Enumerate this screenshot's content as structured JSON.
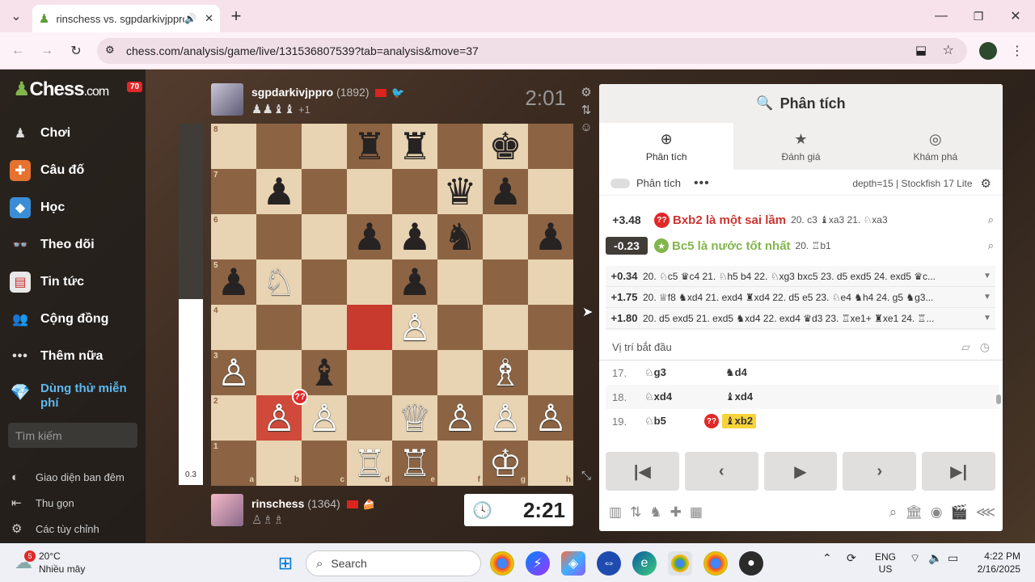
{
  "browser": {
    "tab_title": "rinschess vs. sgpdarkivjppro",
    "url": "chess.com/analysis/game/live/131536807539?tab=analysis&move=37"
  },
  "sidebar": {
    "logo": "Chess",
    "logo_suffix": ".com",
    "badge": "70",
    "items": [
      {
        "label": "Chơi",
        "icon": "pawn-icon"
      },
      {
        "label": "Câu đố",
        "icon": "puzzle-icon"
      },
      {
        "label": "Học",
        "icon": "cube-icon"
      },
      {
        "label": "Theo dõi",
        "icon": "binoculars-icon"
      },
      {
        "label": "Tin tức",
        "icon": "newspaper-icon"
      },
      {
        "label": "Cộng đồng",
        "icon": "people-icon"
      },
      {
        "label": "Thêm nữa",
        "icon": "dots-icon"
      }
    ],
    "trial_line1": "Dùng thử miễn",
    "trial_line2": "phí",
    "search_placeholder": "Tìm kiếm",
    "dark_mode": "Giao diện ban đêm",
    "collapse": "Thu gọn",
    "settings": "Các tùy chỉnh"
  },
  "eval_bar": {
    "value": "0.3",
    "white_fraction": 0.515
  },
  "top_player": {
    "name": "sgpdarkivjppro",
    "rating": "(1892)",
    "captured": "♟♟♝♝",
    "captured_extra": "+1",
    "clock": "2:01"
  },
  "bottom_player": {
    "name": "rinschess",
    "rating": "(1364)",
    "captured": "♙♗♗",
    "clock": "2:21"
  },
  "board": {
    "rank8": [
      "",
      "",
      "",
      "♜",
      "♜",
      "",
      "♚",
      ""
    ],
    "rank7": [
      "",
      "♟",
      "",
      "",
      "",
      "♛",
      "♟",
      ""
    ],
    "rank6": [
      "",
      "",
      "",
      "♟",
      "♟",
      "♞",
      "",
      "♟"
    ],
    "rank5": [
      "♟",
      "♘",
      "",
      "",
      "♟",
      "",
      "",
      ""
    ],
    "rank4": [
      "",
      "",
      "",
      "",
      "♙",
      "",
      "",
      ""
    ],
    "rank3": [
      "♙",
      "",
      "♝",
      "",
      "",
      "",
      "♗",
      ""
    ],
    "rank2": [
      "",
      "♙",
      "♙",
      "",
      "♕",
      "♙",
      "♙",
      "♙"
    ],
    "rank1": [
      "",
      "",
      "",
      "♖",
      "♖",
      "",
      "♔",
      ""
    ],
    "files": [
      "a",
      "b",
      "c",
      "d",
      "e",
      "f",
      "g",
      "h"
    ],
    "ranks": [
      "8",
      "7",
      "6",
      "5",
      "4",
      "3",
      "2",
      "1"
    ],
    "blunder_mark": "??"
  },
  "panel": {
    "title": "Phân tích",
    "tabs": [
      "Phân tích",
      "Đánh giá",
      "Khám phá"
    ],
    "analysis_toggle": "Phân tích",
    "engine": "depth=15 | Stockfish 17 Lite",
    "played": {
      "eval": "+3.48",
      "text": "Bxb2 là một sai lầm",
      "line": "20. c3 ♝xa3 21. ♘xa3"
    },
    "best": {
      "eval": "-0.23",
      "text": "Bc5 là nước tốt nhất",
      "line": "20. ♖b1"
    },
    "lines": [
      {
        "eval": "+0.34",
        "moves": "20. ♘c5 ♛c4 21. ♘h5 b4 22. ♘xg3 bxc5 23. d5 exd5 24. exd5 ♛c..."
      },
      {
        "eval": "+1.75",
        "moves": "20. ♕f8 ♞xd4 21. exd4 ♜xd4 22. d5 e5 23. ♘e4 ♞h4 24. g5 ♞g3..."
      },
      {
        "eval": "+1.80",
        "moves": "20. d5 exd5 21. exd5 ♞xd4 22. exd4 ♛d3 23. ♖xe1+ ♜xe1 24. ♖..."
      }
    ],
    "start_position": "Vị trí bắt đầu",
    "moves": [
      {
        "no": "17.",
        "white": "♘g3",
        "black": "♞d4"
      },
      {
        "no": "18.",
        "white": "♘xd4",
        "black": "♝xd4"
      },
      {
        "no": "19.",
        "white": "♘b5",
        "black": "♝xb2",
        "blunder": "??"
      }
    ]
  },
  "taskbar": {
    "temp": "20°C",
    "weather": "Nhiều mây",
    "weather_badge": "5",
    "search": "Search",
    "lang1": "ENG",
    "lang2": "US",
    "time": "4:22 PM",
    "date": "2/16/2025"
  }
}
